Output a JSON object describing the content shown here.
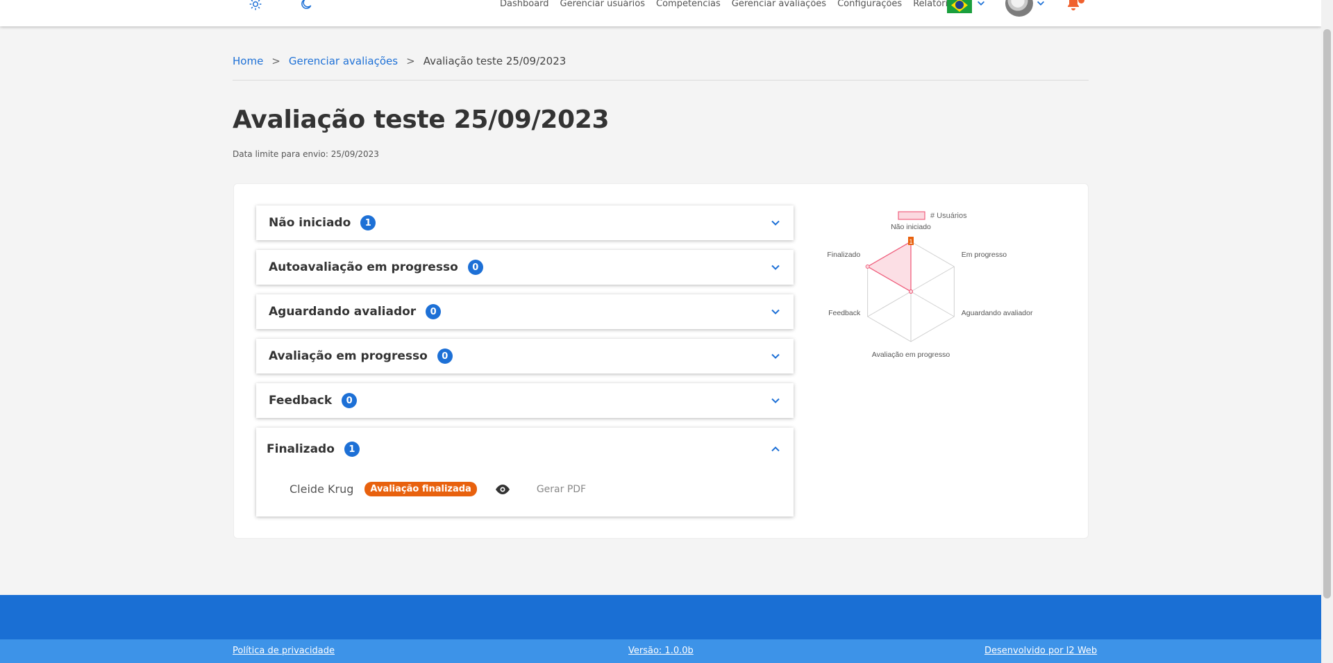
{
  "nav": {
    "items": [
      "Dashboard",
      "Gerenciar usuários",
      "Competencias",
      "Gerenciar avaliações",
      "Configurações",
      "Relatórios"
    ]
  },
  "breadcrumb": {
    "home": "Home",
    "sep": ">",
    "parent": "Gerenciar avaliações",
    "current": "Avaliação teste 25/09/2023"
  },
  "page": {
    "title": "Avaliação teste 25/09/2023",
    "deadline": "Data limite para envio: 25/09/2023"
  },
  "sections": [
    {
      "label": "Não iniciado",
      "count": "1"
    },
    {
      "label": "Autoavaliação em progresso",
      "count": "0"
    },
    {
      "label": "Aguardando avaliador",
      "count": "0"
    },
    {
      "label": "Avaliação em progresso",
      "count": "0"
    },
    {
      "label": "Feedback",
      "count": "0"
    },
    {
      "label": "Finalizado",
      "count": "1"
    }
  ],
  "finalized_entry": {
    "name": "Cleide Krug",
    "status": "Avaliação finalizada",
    "pdf_label": "Gerar PDF"
  },
  "chart_data": {
    "type": "radar",
    "legend": "# Usuários",
    "categories": [
      "Não iniciado",
      "Em progresso",
      "Aguardando avaliador",
      "Avaliação em progresso",
      "Feedback",
      "Finalizado"
    ],
    "values": [
      1,
      0,
      0,
      0,
      0,
      1
    ],
    "rmax": 1,
    "data_label": "1",
    "colors": {
      "fill": "#fbd9e0",
      "line": "#f0607e",
      "grid": "#cfcfcf",
      "label_box": "#e8610e"
    }
  },
  "footer": {
    "privacy": "Política de privacidade",
    "version": "Versão: 1.0.0b",
    "developer": "Desenvolvido por I2 Web"
  },
  "colors": {
    "primary": "#1d70d6",
    "accent": "#e8610e",
    "footer": "#1a6fd4"
  }
}
